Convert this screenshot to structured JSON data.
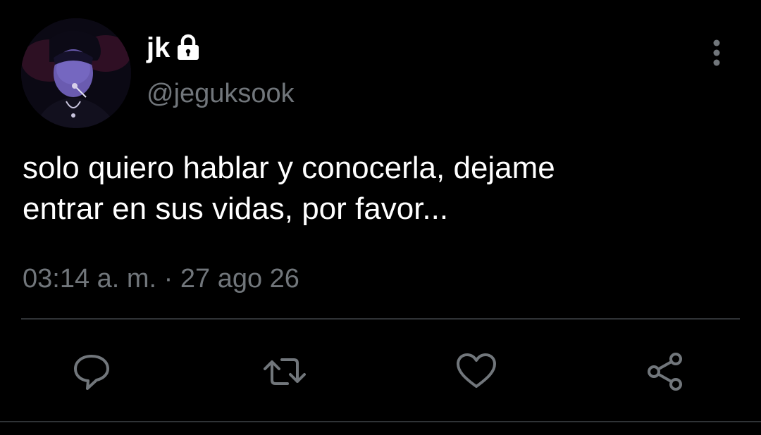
{
  "tweet": {
    "display_name": "jk",
    "handle": "@jeguksook",
    "protected": true,
    "text": "solo quiero hablar y conocerla, dejame\nentrar en sus vidas, por favor...",
    "timestamp": "03:14 a. m. · 27 ago 26",
    "avatar": "profile-photo"
  },
  "actions": [
    {
      "icon": "reply-icon"
    },
    {
      "icon": "retweet-icon"
    },
    {
      "icon": "like-icon"
    },
    {
      "icon": "share-icon"
    }
  ],
  "colors": {
    "background": "#000000",
    "primary_text": "#ffffff",
    "secondary_text": "#71767b",
    "divider": "#2f3336",
    "icon": "#71767b"
  }
}
